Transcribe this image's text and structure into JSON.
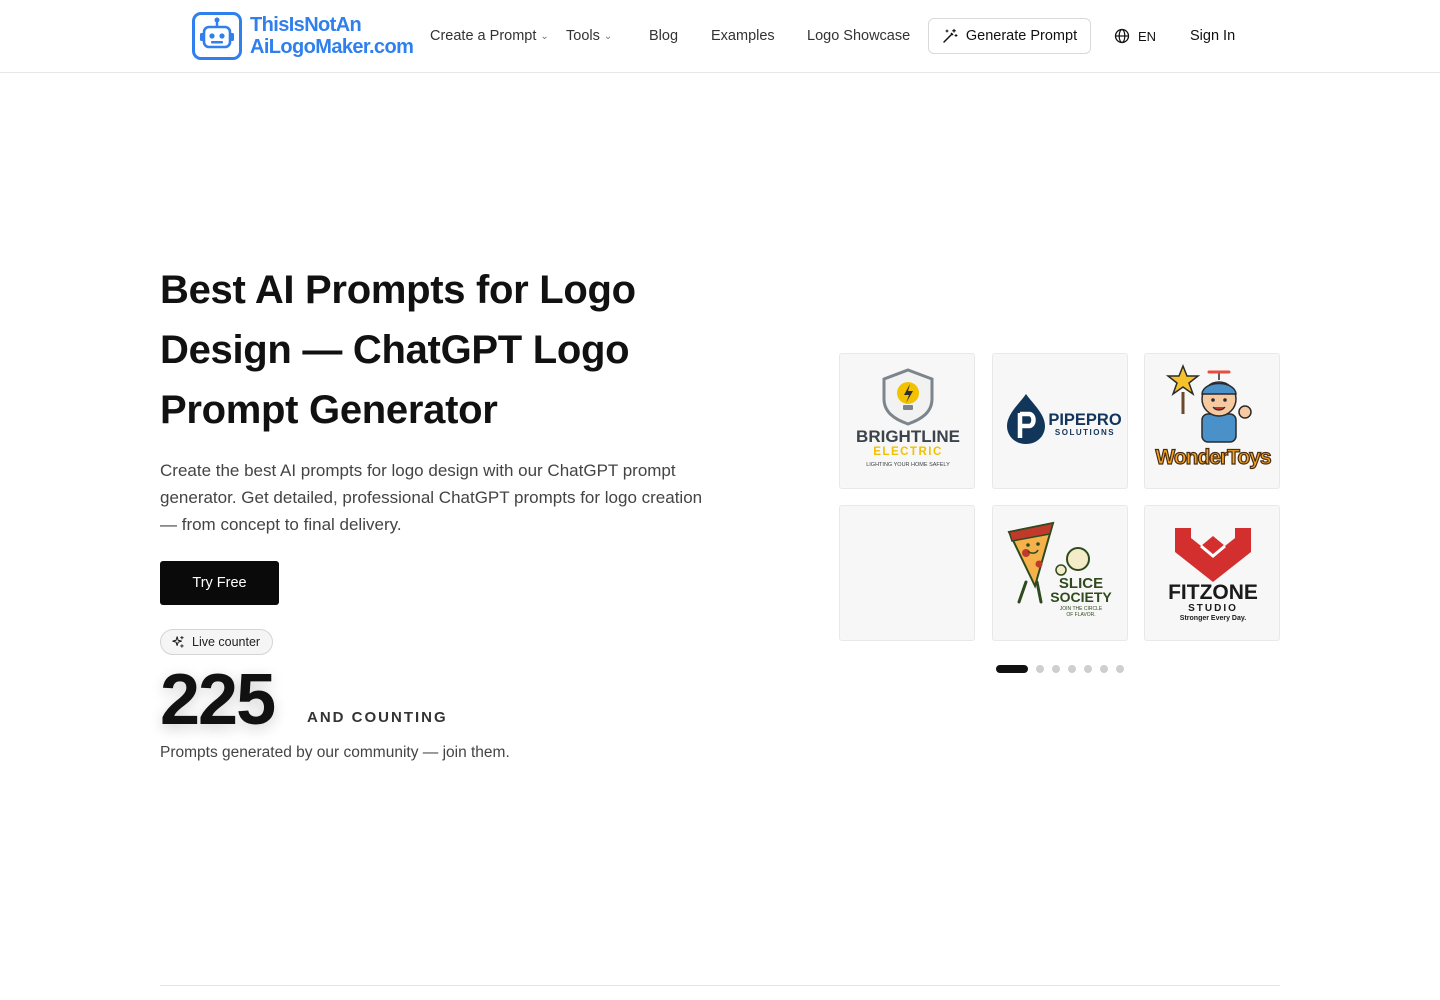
{
  "brand": {
    "line1": "ThisIsNotAn",
    "line2": "AiLogoMaker.com",
    "icon": "robot-icon",
    "color": "#2f80ed"
  },
  "nav": {
    "create_prompt": "Create a Prompt",
    "tools": "Tools",
    "blog": "Blog",
    "examples": "Examples",
    "logo_showcase": "Logo Showcase",
    "generate_prompt": "Generate Prompt",
    "language": "EN",
    "sign_in": "Sign In"
  },
  "hero": {
    "title": "Best AI Prompts for Logo Design — ChatGPT Logo Prompt Generator",
    "description": "Create the best AI prompts for logo design with our ChatGPT prompt generator. Get detailed, professional ChatGPT prompts for logo creation — from concept to final delivery.",
    "cta": "Try Free",
    "badge": "Live counter",
    "count": "225",
    "count_label": "AND COUNTING",
    "count_sub": "Prompts generated by our community — join them."
  },
  "gallery": {
    "cards": [
      {
        "name": "BRIGHTLINE",
        "sub": "ELECTRIC",
        "tagline": "LIGHTING YOUR HOME SAFELY"
      },
      {
        "name": "PIPEPRO",
        "sub": "SOLUTIONS"
      },
      {
        "name": "WonderToys"
      },
      {
        "name": ""
      },
      {
        "name": "SLICE",
        "sub": "SOCIETY",
        "tagline1": "JOIN THE CIRCLE",
        "tagline2": "OF FLAVOR."
      },
      {
        "name": "FITZONE",
        "sub": "STUDIO",
        "tagline": "Stronger Every Day."
      }
    ],
    "slide_count": 7,
    "active_slide": 1
  },
  "colors": {
    "accent": "#2f80ed",
    "cta_bg": "#0a0a0a",
    "brightline_yellow": "#f2c200",
    "pipepro_navy": "#12365a",
    "wonder_orange": "#f5a623",
    "slice_green": "#2f4a1e",
    "fitzone_red": "#d32f2f"
  }
}
